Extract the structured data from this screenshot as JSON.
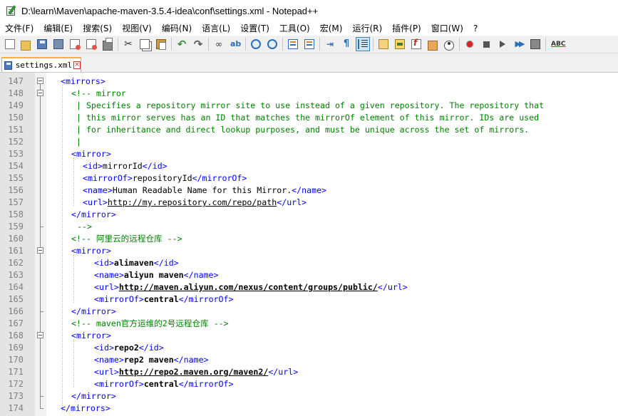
{
  "window": {
    "title": "D:\\learn\\Maven\\apache-maven-3.5.4-idea\\conf\\settings.xml - Notepad++"
  },
  "menu": [
    {
      "label": "文件(F)"
    },
    {
      "label": "编辑(E)"
    },
    {
      "label": "搜索(S)"
    },
    {
      "label": "视图(V)"
    },
    {
      "label": "编码(N)"
    },
    {
      "label": "语言(L)"
    },
    {
      "label": "设置(T)"
    },
    {
      "label": "工具(O)"
    },
    {
      "label": "宏(M)"
    },
    {
      "label": "运行(R)"
    },
    {
      "label": "插件(P)"
    },
    {
      "label": "窗口(W)"
    },
    {
      "label": "?"
    }
  ],
  "toolbar": {
    "icons": [
      "new-file-icon",
      "open-file-icon",
      "save-icon",
      "save-all-icon",
      "close-icon",
      "close-all-icon",
      "print-icon",
      "cut-icon",
      "copy-icon",
      "paste-icon",
      "undo-icon",
      "redo-icon",
      "find-icon",
      "replace-icon",
      "zoom-in-icon",
      "zoom-out-icon",
      "sync-vertical-icon",
      "sync-horizontal-icon",
      "word-wrap-icon",
      "show-all-chars-icon",
      "indent-guide-icon",
      "user-defined-lang-icon",
      "document-map-icon",
      "function-list-icon",
      "folder-workspace-icon",
      "monitoring-icon",
      "record-macro-icon",
      "stop-macro-icon",
      "play-macro-icon",
      "run-macro-multiple-icon",
      "save-macro-icon",
      "spell-check-icon"
    ],
    "spell_label": "ABC"
  },
  "tab": {
    "label": "settings.xml",
    "close": "×"
  },
  "editor": {
    "lines": [
      {
        "n": "147"
      },
      {
        "n": "148"
      },
      {
        "n": "149"
      },
      {
        "n": "150"
      },
      {
        "n": "151"
      },
      {
        "n": "152"
      },
      {
        "n": "153"
      },
      {
        "n": "154"
      },
      {
        "n": "155"
      },
      {
        "n": "156"
      },
      {
        "n": "157"
      },
      {
        "n": "158"
      },
      {
        "n": "159"
      },
      {
        "n": "160"
      },
      {
        "n": "161"
      },
      {
        "n": "162"
      },
      {
        "n": "163"
      },
      {
        "n": "164"
      },
      {
        "n": "165"
      },
      {
        "n": "166"
      },
      {
        "n": "167"
      },
      {
        "n": "168"
      },
      {
        "n": "169"
      },
      {
        "n": "170"
      },
      {
        "n": "171"
      },
      {
        "n": "172"
      },
      {
        "n": "173"
      },
      {
        "n": "174"
      }
    ],
    "code": {
      "l147_tag": "<mirrors>",
      "l148": "<!-- mirror",
      "l149": " | Specifies a repository mirror site to use instead of a given repository. The repository that",
      "l150": " | this mirror serves has an ID that matches the mirrorOf element of this mirror. IDs are used",
      "l151": " | for inheritance and direct lookup purposes, and must be unique across the set of mirrors.",
      "l152": " |",
      "l153_tag": "<mirror>",
      "l154_open": "<id>",
      "l154_text": "mirrorId",
      "l154_close": "</id>",
      "l155_open": "<mirrorOf>",
      "l155_text": "repositoryId",
      "l155_close": "</mirrorOf>",
      "l156_open": "<name>",
      "l156_text": "Human Readable Name for this Mirror.",
      "l156_close": "</name>",
      "l157_open": "<url>",
      "l157_text": "http://my.repository.com/repo/path",
      "l157_close": "</url>",
      "l158_tag": "</mirror>",
      "l159": "-->",
      "l160": "<!-- 阿里云的远程仓库 -->",
      "l161_tag": "<mirror>",
      "l162_open": "<id>",
      "l162_text": "alimaven",
      "l162_close": "</id>",
      "l163_open": "<name>",
      "l163_text": "aliyun maven",
      "l163_close": "</name>",
      "l164_open": "<url>",
      "l164_text": "http://maven.aliyun.com/nexus/content/groups/public/",
      "l164_close": "</url>",
      "l165_open": "<mirrorOf>",
      "l165_text": "central",
      "l165_close": "</mirrorOf>",
      "l166_tag": "</mirror>",
      "l167": "<!-- maven官方运维的2号远程仓库 -->",
      "l168_tag": "<mirror>",
      "l169_open": "<id>",
      "l169_text": "repo2",
      "l169_close": "</id>",
      "l170_open": "<name>",
      "l170_text": "rep2 maven",
      "l170_close": "</name>",
      "l171_open": "<url>",
      "l171_text": "http://repo2.maven.org/maven2/",
      "l171_close": "</url>",
      "l172_open": "<mirrorOf>",
      "l172_text": "central",
      "l172_close": "</mirrorOf>",
      "l173_tag": "</mirror>",
      "l174_tag": "</mirrors>"
    }
  },
  "colors": {
    "tag": "#0000ff",
    "comment": "#008000",
    "line_number": "#808080",
    "active_tab_accent": "#f7b045"
  }
}
